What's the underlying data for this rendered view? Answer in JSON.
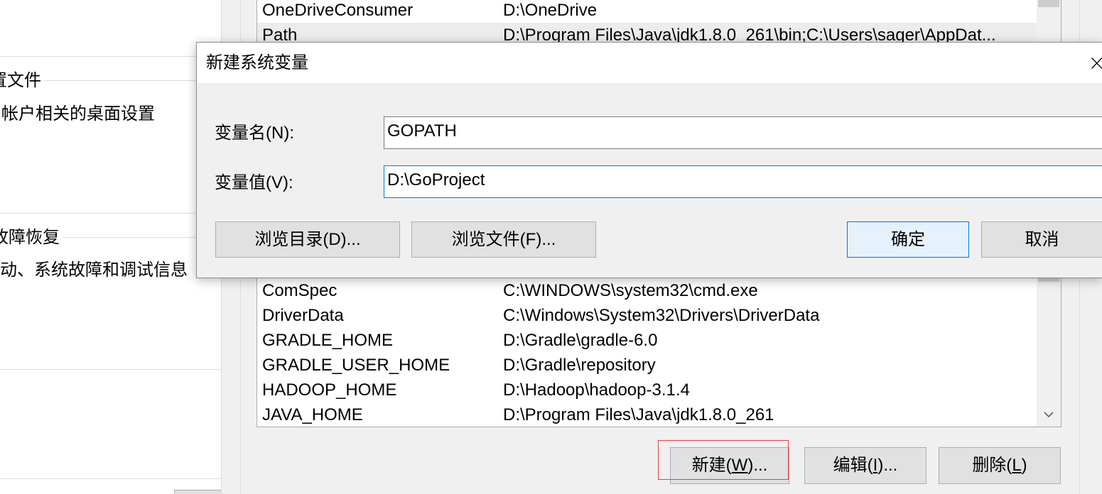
{
  "system_properties": {
    "user_profiles_label": "置文件",
    "user_profiles_desc": "帐户相关的桌面设置",
    "startup_recovery_label": "故障恢复",
    "startup_recovery_desc": "动、系统故障和调试信息"
  },
  "environment_variables": {
    "user_variables": [
      {
        "name": "OneDriveConsumer",
        "value": "D:\\OneDrive"
      },
      {
        "name": "Path",
        "value": "D:\\Program Files\\Java\\jdk1.8.0_261\\bin;C:\\Users\\sager\\AppDat...",
        "selected": true
      }
    ],
    "system_variables": [
      {
        "name": "ComSpec",
        "value": "C:\\WINDOWS\\system32\\cmd.exe"
      },
      {
        "name": "DriverData",
        "value": "C:\\Windows\\System32\\Drivers\\DriverData"
      },
      {
        "name": "GRADLE_HOME",
        "value": "D:\\Gradle\\gradle-6.0"
      },
      {
        "name": "GRADLE_USER_HOME",
        "value": "D:\\Gradle\\repository"
      },
      {
        "name": "HADOOP_HOME",
        "value": "D:\\Hadoop\\hadoop-3.1.4"
      },
      {
        "name": "JAVA_HOME",
        "value": "D:\\Program Files\\Java\\jdk1.8.0_261"
      }
    ],
    "system_buttons": {
      "new": {
        "prefix": "新建(",
        "key": "W",
        "suffix": ")...",
        "annotated": true
      },
      "edit": {
        "prefix": "编辑(",
        "key": "I",
        "suffix": ")..."
      },
      "delete": {
        "prefix": "删除(",
        "key": "L",
        "suffix": ")"
      }
    }
  },
  "new_variable_dialog": {
    "title": "新建系统变量",
    "name_label": "变量名(N):",
    "name_value": "GOPATH",
    "value_label": "变量值(V):",
    "value_value": "D:\\GoProject",
    "value_field_focused": true,
    "browse_directory": "浏览目录(D)...",
    "browse_file": "浏览文件(F)...",
    "ok": "确定",
    "cancel": "取消"
  },
  "icons": {
    "close": "close-icon",
    "scroll_down": "chevron-down-icon"
  },
  "colors": {
    "accent": "#0078d7",
    "ok_button_bg": "#e5f1fb",
    "annotation": "#e8403a",
    "window_bg": "#f0f0f0"
  }
}
